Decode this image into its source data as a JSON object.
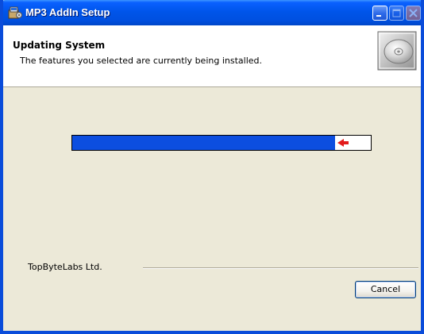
{
  "window": {
    "title": "MP3 AddIn Setup",
    "icons": {
      "app": "setup-package-icon",
      "minimize": "minimize-icon",
      "maximize": "maximize-icon",
      "close": "close-icon",
      "banner": "cd-disc-icon"
    }
  },
  "header": {
    "title": "Updating System",
    "subtitle": "The features you selected are currently being installed."
  },
  "progress": {
    "fraction": 0.88,
    "fill_color": "#0c4ee0",
    "marker_color": "#e21b1b"
  },
  "footer": {
    "brand": "TopByteLabs Ltd.",
    "cancel_label": "Cancel"
  }
}
